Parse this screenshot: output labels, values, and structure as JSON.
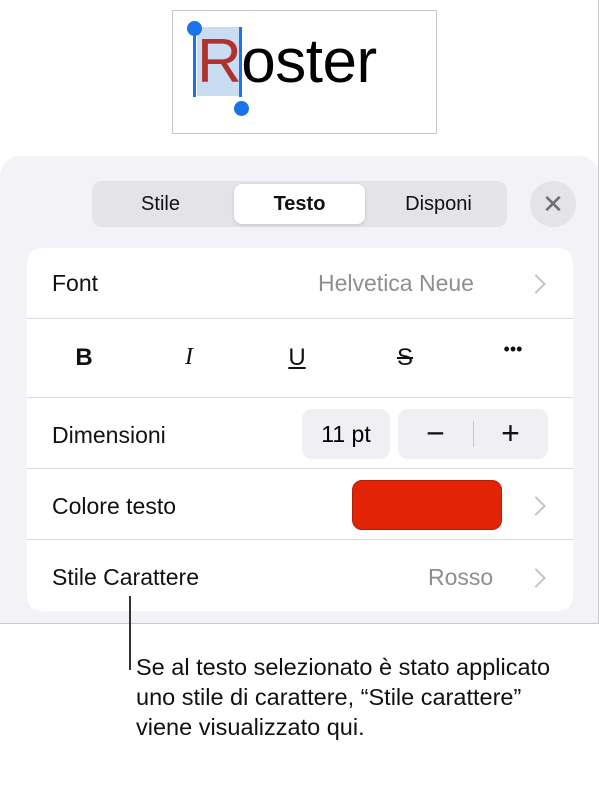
{
  "canvas": {
    "text": "Roster",
    "selected_letter": "R",
    "rest_text": "oster"
  },
  "tabs": [
    {
      "label": "Stile",
      "active": false
    },
    {
      "label": "Testo",
      "active": true
    },
    {
      "label": "Disponi",
      "active": false
    }
  ],
  "close_symbol": "✕",
  "font_row": {
    "label": "Font",
    "value": "Helvetica Neue"
  },
  "format_buttons": {
    "bold": "B",
    "italic": "I",
    "underline": "U",
    "strikethrough": "S",
    "more": "•••"
  },
  "size_row": {
    "label": "Dimensioni",
    "value": "11 pt",
    "decrement": "−",
    "increment": "+"
  },
  "color_row": {
    "label": "Colore testo",
    "swatch_color": "#e22306"
  },
  "char_style_row": {
    "label": "Stile Carattere",
    "value": "Rosso"
  },
  "callout": {
    "text": "Se al testo selezionato è stato applicato uno stile di carattere, “Stile carattere” viene visualizzato qui."
  }
}
